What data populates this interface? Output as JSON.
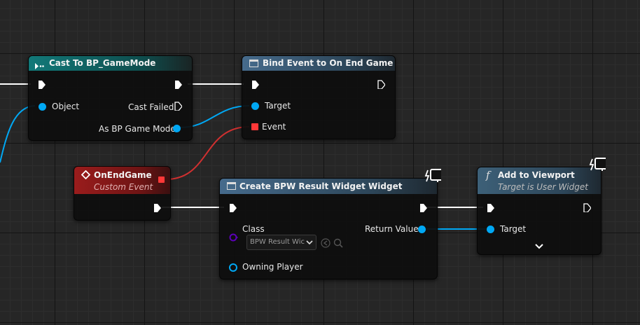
{
  "nodes": {
    "cast": {
      "title": "Cast To BP_GameMode",
      "object_label": "Object",
      "cast_failed_label": "Cast Failed",
      "as_label": "As BP Game Mode"
    },
    "bind": {
      "title": "Bind Event to On End Game",
      "target_label": "Target",
      "event_label": "Event"
    },
    "custom_event": {
      "title": "OnEndGame",
      "subtitle": "Custom Event"
    },
    "create_widget": {
      "title": "Create BPW Result Widget Widget",
      "class_label": "Class",
      "class_value": "BPW Result Wic",
      "return_label": "Return Value",
      "owning_label": "Owning Player"
    },
    "add_viewport": {
      "title": "Add to Viewport",
      "subtitle": "Target is User Widget",
      "target_label": "Target",
      "func_glyph": "f"
    }
  },
  "colors": {
    "exec": "#ffffff",
    "object_pin": "#00a8f4",
    "delegate_pin": "#ff3838",
    "class_pin": "#5c00b8",
    "cast_header": "#127979",
    "event_header": "#9a1c1c",
    "func_header": "#466b8c"
  }
}
